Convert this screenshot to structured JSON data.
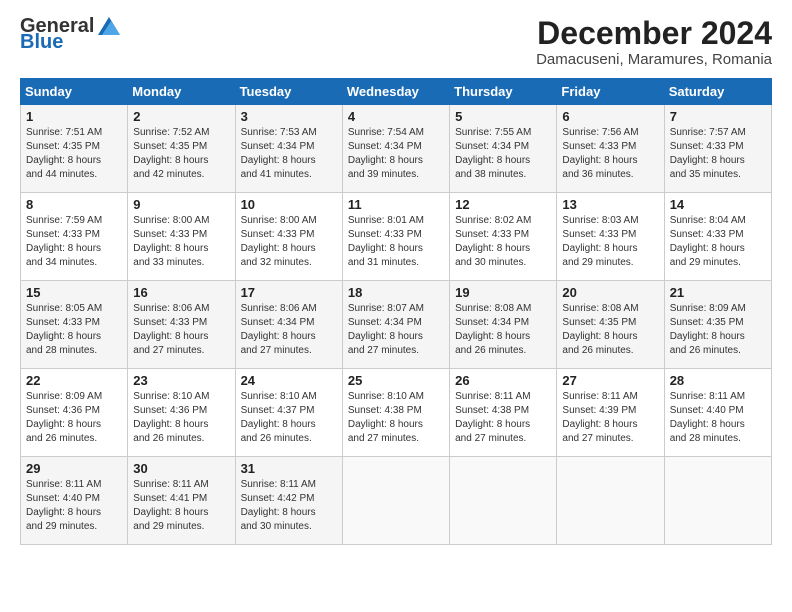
{
  "header": {
    "logo_general": "General",
    "logo_blue": "Blue",
    "title": "December 2024",
    "subtitle": "Damacuseni, Maramures, Romania"
  },
  "days_of_week": [
    "Sunday",
    "Monday",
    "Tuesday",
    "Wednesday",
    "Thursday",
    "Friday",
    "Saturday"
  ],
  "weeks": [
    [
      {
        "day": "1",
        "sunrise": "7:51 AM",
        "sunset": "4:35 PM",
        "daylight": "8 hours and 44 minutes."
      },
      {
        "day": "2",
        "sunrise": "7:52 AM",
        "sunset": "4:35 PM",
        "daylight": "8 hours and 42 minutes."
      },
      {
        "day": "3",
        "sunrise": "7:53 AM",
        "sunset": "4:34 PM",
        "daylight": "8 hours and 41 minutes."
      },
      {
        "day": "4",
        "sunrise": "7:54 AM",
        "sunset": "4:34 PM",
        "daylight": "8 hours and 39 minutes."
      },
      {
        "day": "5",
        "sunrise": "7:55 AM",
        "sunset": "4:34 PM",
        "daylight": "8 hours and 38 minutes."
      },
      {
        "day": "6",
        "sunrise": "7:56 AM",
        "sunset": "4:33 PM",
        "daylight": "8 hours and 36 minutes."
      },
      {
        "day": "7",
        "sunrise": "7:57 AM",
        "sunset": "4:33 PM",
        "daylight": "8 hours and 35 minutes."
      }
    ],
    [
      {
        "day": "8",
        "sunrise": "7:59 AM",
        "sunset": "4:33 PM",
        "daylight": "8 hours and 34 minutes."
      },
      {
        "day": "9",
        "sunrise": "8:00 AM",
        "sunset": "4:33 PM",
        "daylight": "8 hours and 33 minutes."
      },
      {
        "day": "10",
        "sunrise": "8:00 AM",
        "sunset": "4:33 PM",
        "daylight": "8 hours and 32 minutes."
      },
      {
        "day": "11",
        "sunrise": "8:01 AM",
        "sunset": "4:33 PM",
        "daylight": "8 hours and 31 minutes."
      },
      {
        "day": "12",
        "sunrise": "8:02 AM",
        "sunset": "4:33 PM",
        "daylight": "8 hours and 30 minutes."
      },
      {
        "day": "13",
        "sunrise": "8:03 AM",
        "sunset": "4:33 PM",
        "daylight": "8 hours and 29 minutes."
      },
      {
        "day": "14",
        "sunrise": "8:04 AM",
        "sunset": "4:33 PM",
        "daylight": "8 hours and 29 minutes."
      }
    ],
    [
      {
        "day": "15",
        "sunrise": "8:05 AM",
        "sunset": "4:33 PM",
        "daylight": "8 hours and 28 minutes."
      },
      {
        "day": "16",
        "sunrise": "8:06 AM",
        "sunset": "4:33 PM",
        "daylight": "8 hours and 27 minutes."
      },
      {
        "day": "17",
        "sunrise": "8:06 AM",
        "sunset": "4:34 PM",
        "daylight": "8 hours and 27 minutes."
      },
      {
        "day": "18",
        "sunrise": "8:07 AM",
        "sunset": "4:34 PM",
        "daylight": "8 hours and 27 minutes."
      },
      {
        "day": "19",
        "sunrise": "8:08 AM",
        "sunset": "4:34 PM",
        "daylight": "8 hours and 26 minutes."
      },
      {
        "day": "20",
        "sunrise": "8:08 AM",
        "sunset": "4:35 PM",
        "daylight": "8 hours and 26 minutes."
      },
      {
        "day": "21",
        "sunrise": "8:09 AM",
        "sunset": "4:35 PM",
        "daylight": "8 hours and 26 minutes."
      }
    ],
    [
      {
        "day": "22",
        "sunrise": "8:09 AM",
        "sunset": "4:36 PM",
        "daylight": "8 hours and 26 minutes."
      },
      {
        "day": "23",
        "sunrise": "8:10 AM",
        "sunset": "4:36 PM",
        "daylight": "8 hours and 26 minutes."
      },
      {
        "day": "24",
        "sunrise": "8:10 AM",
        "sunset": "4:37 PM",
        "daylight": "8 hours and 26 minutes."
      },
      {
        "day": "25",
        "sunrise": "8:10 AM",
        "sunset": "4:38 PM",
        "daylight": "8 hours and 27 minutes."
      },
      {
        "day": "26",
        "sunrise": "8:11 AM",
        "sunset": "4:38 PM",
        "daylight": "8 hours and 27 minutes."
      },
      {
        "day": "27",
        "sunrise": "8:11 AM",
        "sunset": "4:39 PM",
        "daylight": "8 hours and 27 minutes."
      },
      {
        "day": "28",
        "sunrise": "8:11 AM",
        "sunset": "4:40 PM",
        "daylight": "8 hours and 28 minutes."
      }
    ],
    [
      {
        "day": "29",
        "sunrise": "8:11 AM",
        "sunset": "4:40 PM",
        "daylight": "8 hours and 29 minutes."
      },
      {
        "day": "30",
        "sunrise": "8:11 AM",
        "sunset": "4:41 PM",
        "daylight": "8 hours and 29 minutes."
      },
      {
        "day": "31",
        "sunrise": "8:11 AM",
        "sunset": "4:42 PM",
        "daylight": "8 hours and 30 minutes."
      },
      null,
      null,
      null,
      null
    ]
  ]
}
